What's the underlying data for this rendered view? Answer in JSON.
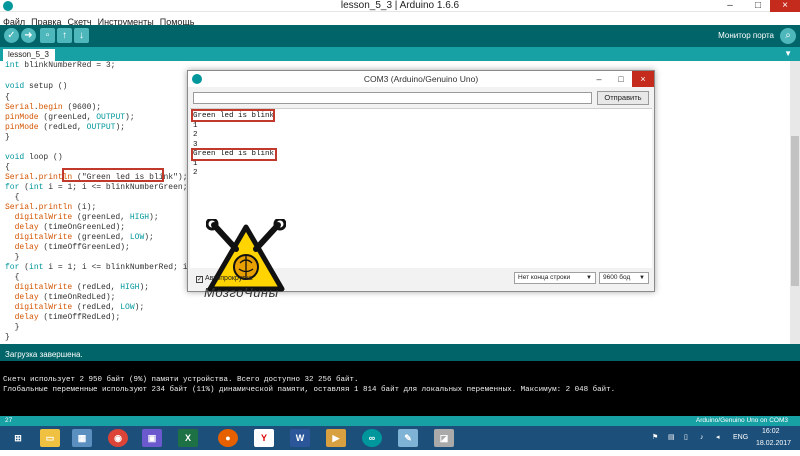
{
  "window": {
    "title": "lesson_5_3 | Arduino 1.6.6",
    "controls": [
      "–",
      "□",
      "×"
    ]
  },
  "menu": [
    "Файл",
    "Правка",
    "Скетч",
    "Инструменты",
    "Помощь"
  ],
  "toolbar": {
    "serial_monitor_label": "Монитор порта",
    "icons": [
      "verify-icon",
      "upload-icon",
      "new-icon",
      "open-icon",
      "save-icon"
    ]
  },
  "tab": {
    "name": "lesson_5_3"
  },
  "code_lines": [
    "int blinkNumberRed = 3;",
    "",
    "void setup ()",
    "{",
    "Serial.begin (9600);",
    "pinMode (greenLed, OUTPUT);",
    "pinMode (redLed, OUTPUT);",
    "}",
    "",
    "void loop ()",
    "{",
    "Serial.println (\"Green led is blink\");",
    "for (int i = 1; i <= blinkNumberGreen; i++)",
    "  {",
    "Serial.println (i);",
    "  digitalWrite (greenLed, HIGH);",
    "  delay (timeOnGreenLed);",
    "  digitalWrite (greenLed, LOW);",
    "  delay (timeOffGreenLed);",
    "  }",
    "for (int i = 1; i <= blinkNumberRed; i++)",
    "  {",
    "  digitalWrite (redLed, HIGH);",
    "  delay (timeOnRedLed);",
    "  digitalWrite (redLed, LOW);",
    "  delay (timeOffRedLed);",
    "  }",
    "}"
  ],
  "status": {
    "text": "Загрузка завершена."
  },
  "console_lines": [
    "Скетч использует 2 950 байт (9%) памяти устройства. Всего доступно 32 256 байт.",
    "Глобальные переменные используют 234 байт (11%) динамической памяти, оставляя 1 814 байт для локальных переменных. Максимум: 2 048 байт."
  ],
  "bottom_bar": {
    "line": "27",
    "board": "Arduino/Genuino Uno on COM3"
  },
  "serial_monitor": {
    "title": "COM3 (Arduino/Genuino Uno)",
    "input_value": "",
    "send_label": "Отправить",
    "output": [
      "Green led is blink",
      "1",
      "2",
      "3",
      "Green led is blink",
      "1",
      "2"
    ],
    "autoscroll_label": "Автопрокрутка",
    "autoscroll_checked": true,
    "line_ending": "Нет конца строки",
    "baud": "9600 бод",
    "logo_text": "МозгоЧины"
  },
  "taskbar": {
    "lang": "ENG",
    "time": "16:02",
    "date": "18.02.2017"
  },
  "colors": {
    "toolbar": "#006468",
    "tabstrip": "#17a1a5",
    "highlight": "#c0392b",
    "taskbar": "#1c4f7a"
  }
}
